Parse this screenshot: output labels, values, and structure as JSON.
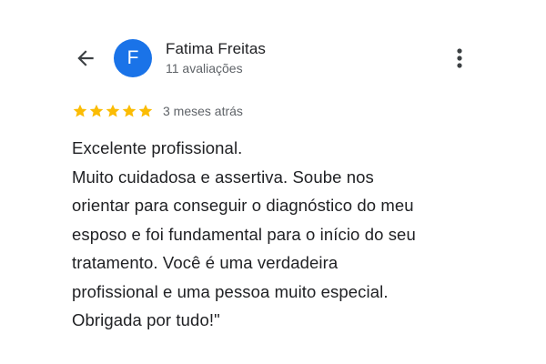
{
  "colors": {
    "avatar_bg": "#1a73e8",
    "star": "#fbbc04",
    "primary_text": "#202124",
    "secondary_text": "#5f6368"
  },
  "header": {
    "back_icon": "arrow-left-icon",
    "avatar_letter": "F",
    "reviewer_name": "Fatima Freitas",
    "review_count": "11 avaliações",
    "more_icon": "more-vert-icon"
  },
  "review": {
    "rating": 5,
    "max_rating": 5,
    "date": "3 meses atrás",
    "lines": [
      "Excelente profissional.",
      "Muito cuidadosa e assertiva. Soube nos",
      "orientar para conseguir o diagnóstico do meu",
      "esposo e foi fundamental para o início do seu",
      "tratamento. Você é uma verdadeira",
      "profissional e uma pessoa muito especial.",
      "Obrigada por tudo!\""
    ]
  }
}
